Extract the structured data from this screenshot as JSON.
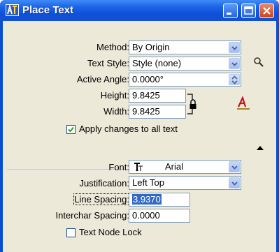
{
  "window": {
    "title": "Place Text"
  },
  "form": {
    "method": {
      "label": "Method:",
      "value": "By Origin"
    },
    "text_style": {
      "label": "Text Style:",
      "value": "Style (none)"
    },
    "active_angle": {
      "label": "Active Angle:",
      "value": "0.0000°"
    },
    "height": {
      "label": "Height:",
      "value": "9.8425"
    },
    "width": {
      "label": "Width:",
      "value": "9.8425"
    },
    "apply_changes": {
      "label": "Apply changes to all text",
      "checked": true
    },
    "font": {
      "label": "Font:",
      "value": "Arial"
    },
    "justification": {
      "label": "Justification:",
      "value": "Left Top"
    },
    "line_spacing": {
      "label": "Line Spacing:",
      "value": "3.9370"
    },
    "interchar_spacing": {
      "label": "Interchar Spacing:",
      "value": "0.0000"
    },
    "text_node_lock": {
      "label": "Text Node Lock",
      "checked": false
    }
  },
  "icons": [
    "application-icon",
    "minimize-icon",
    "maximize-icon",
    "close-icon",
    "magnifier-icon",
    "lock-icon",
    "text-style-icon",
    "collapse-arrow-icon",
    "truetype-font-icon"
  ],
  "colors": {
    "titlebar": "#1c62e6",
    "client": "#ece9d8",
    "selection": "#316ac5",
    "close_button": "#c7431c"
  }
}
